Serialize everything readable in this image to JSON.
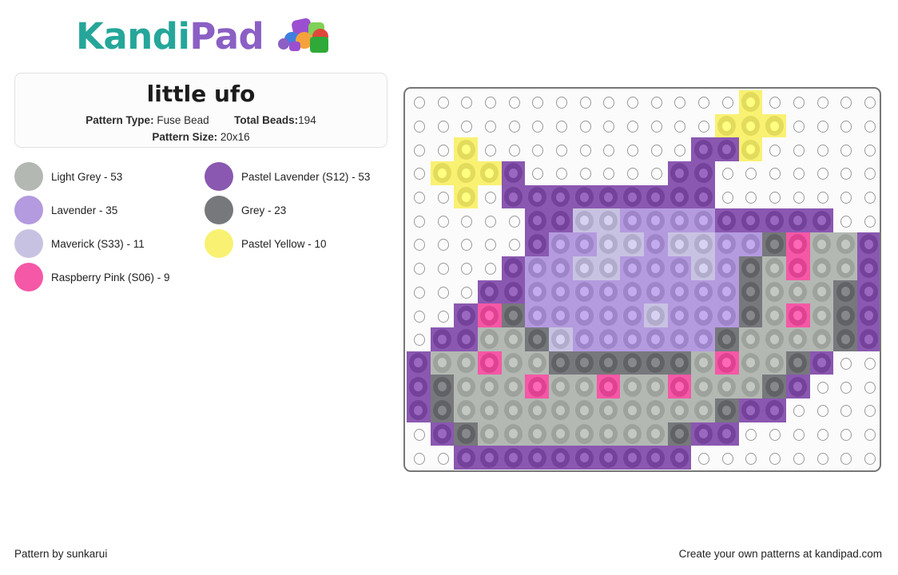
{
  "brand": {
    "name_part1": "Kandi",
    "name_part2": "Pad",
    "teal": "#26a69a",
    "purple": "#8b5fc4"
  },
  "info_card": {
    "title": "little ufo",
    "pattern_type_label": "Pattern Type:",
    "pattern_type_value": "Fuse Bead",
    "total_beads_label": "Total Beads:",
    "total_beads_value": "194",
    "pattern_size_label": "Pattern Size:",
    "pattern_size_value": "20x16"
  },
  "legend": [
    {
      "key": "light_grey",
      "label": "Light Grey - 53",
      "color": "#b3b8b3",
      "count": 53
    },
    {
      "key": "pastel_lavender",
      "label": "Pastel Lavender (S12) - 53",
      "color": "#8a58b0",
      "count": 53
    },
    {
      "key": "lavender",
      "label": "Lavender - 35",
      "color": "#b49ade",
      "count": 35
    },
    {
      "key": "grey",
      "label": "Grey - 23",
      "color": "#77787c",
      "count": 23
    },
    {
      "key": "maverick",
      "label": "Maverick (S33) - 11",
      "color": "#c8c2e2",
      "count": 11
    },
    {
      "key": "pastel_yellow",
      "label": "Pastel Yellow - 10",
      "color": "#f9f172",
      "count": 10
    },
    {
      "key": "raspberry_pink",
      "label": "Raspberry Pink (S06) - 9",
      "color": "#f558a6",
      "count": 9
    }
  ],
  "grid": {
    "cols": 20,
    "rows": 16,
    "empty_peg_color": "#9a9a9a",
    "board_color": "#fbfbfb",
    "color_map": {
      ".": null,
      "L": "#b3b8b3",
      "P": "#8a58b0",
      "V": "#b49ade",
      "G": "#77787c",
      "M": "#c8c2e2",
      "Y": "#f9f172",
      "K": "#f558a6"
    },
    "rows_data": [
      "..............Y.....",
      ".............YYY....",
      "..Y.........PPY.....",
      ".YYYP......PP.......",
      "..Y.PPPPPPPPP.......",
      ".....PPMMVVVVPPPPP..",
      ".....PVVMMVMMVVGKLLP",
      "....PVVMMVVVMVGLKLLP",
      "...PPVVVVVVVVVGLLLGP",
      "..PKGVVVVVMVVVGLKLGP",
      ".PPLLGMVVVVVVGLLLLGP",
      "PLLKLLGGGGGGLKLLGP..",
      "PGLLLKLLKLLKLLLGP...",
      "PGLLLLLLLLLLLGPP....",
      ".PGLLLLLLLLGPP......",
      "..PPPPPPPPPP........"
    ]
  },
  "footer": {
    "left": "Pattern by sunkarui",
    "right": "Create your own patterns at kandipad.com"
  }
}
